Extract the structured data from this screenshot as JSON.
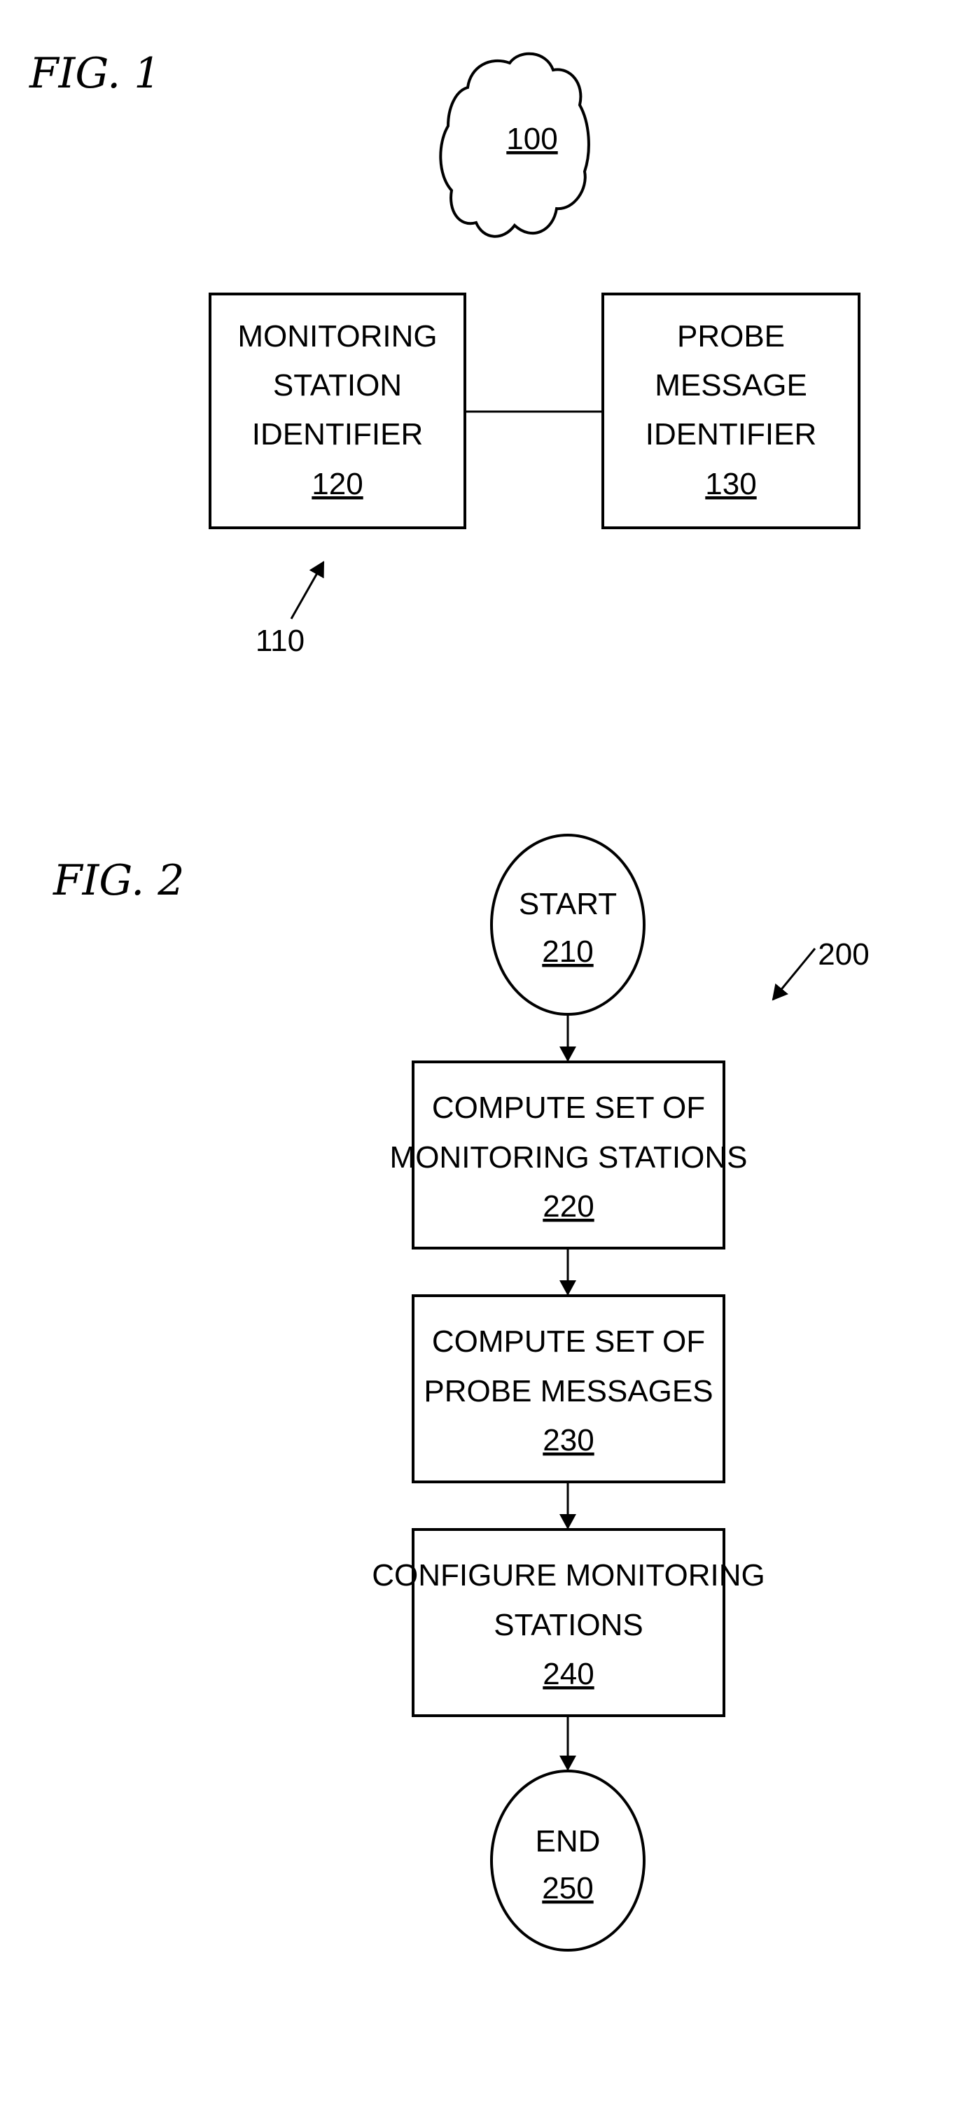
{
  "fig1": {
    "label": "FIG. 1",
    "cloud": {
      "ref": "100"
    },
    "system_ref": "110",
    "boxes": [
      {
        "lines": [
          "MONITORING",
          "STATION",
          "IDENTIFIER"
        ],
        "ref": "120"
      },
      {
        "lines": [
          "PROBE",
          "MESSAGE",
          "IDENTIFIER"
        ],
        "ref": "130"
      }
    ]
  },
  "fig2": {
    "label": "FIG. 2",
    "flow_ref": "200",
    "start": {
      "label": "START",
      "ref": "210"
    },
    "steps": [
      {
        "lines": [
          "COMPUTE SET OF",
          "MONITORING STATIONS"
        ],
        "ref": "220"
      },
      {
        "lines": [
          "COMPUTE SET OF",
          "PROBE MESSAGES"
        ],
        "ref": "230"
      },
      {
        "lines": [
          "CONFIGURE MONITORING",
          "STATIONS"
        ],
        "ref": "240"
      }
    ],
    "end": {
      "label": "END",
      "ref": "250"
    }
  }
}
